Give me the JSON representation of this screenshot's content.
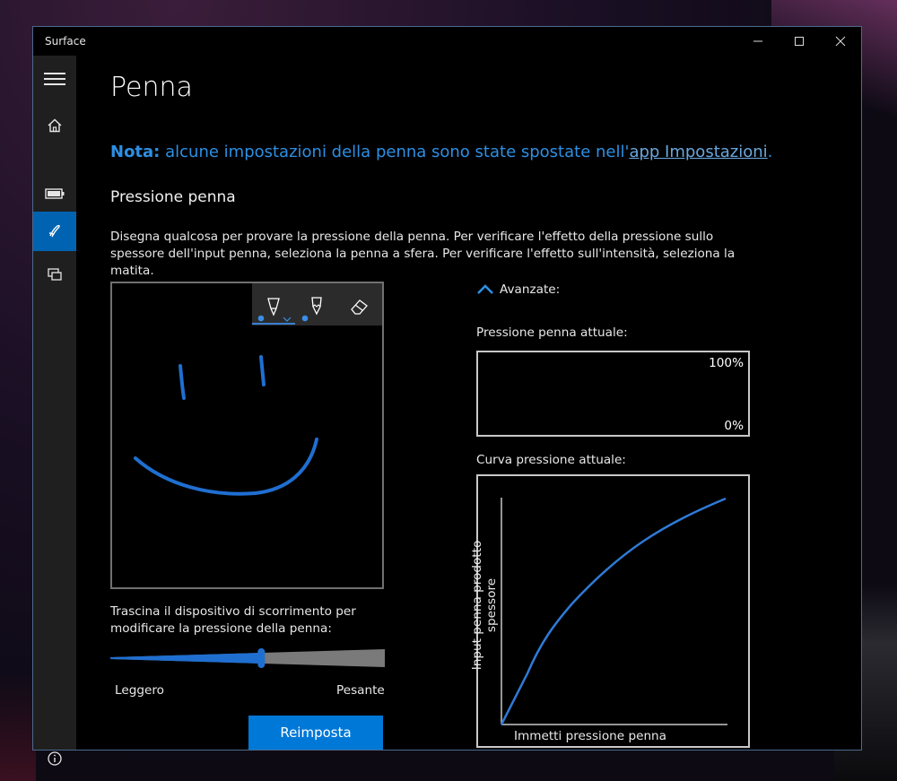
{
  "window": {
    "title": "Surface"
  },
  "page": {
    "title": "Penna",
    "note_bold": "Nota:",
    "note_text": " alcune impostazioni della penna sono state spostate nell'",
    "note_link": "app Impostazioni",
    "note_end": ".",
    "section_title": "Pressione penna",
    "description": "Disegna qualcosa per provare la pressione della penna. Per verificare l'effetto della pressione sullo spessore dell'input penna, seleziona la penna a sfera. Per verificare l'effetto sull'intensità, seleziona la matita."
  },
  "nav": {
    "items": [
      {
        "icon": "hamburger-icon"
      },
      {
        "icon": "home-icon"
      },
      {
        "icon": "battery-icon"
      },
      {
        "icon": "pen-icon",
        "active": true
      },
      {
        "icon": "devices-icon"
      },
      {
        "icon": "info-icon"
      }
    ]
  },
  "toolbar": {
    "tools": [
      "ballpoint-pen-icon",
      "pencil-icon",
      "eraser-icon"
    ],
    "selected": "ballpoint-pen-icon"
  },
  "slider": {
    "hint": "Trascina il dispositivo di scorrimento per modificare la pressione della penna:",
    "left_label": "Leggero",
    "right_label": "Pesante",
    "value": 0.55
  },
  "reset_label": "Reimposta",
  "advanced": {
    "label": "Avanzate:",
    "current_pressure_label": "Pressione penna attuale:",
    "max_label": "100%",
    "min_label": "0%",
    "curve_label": "Curva pressione attuale:",
    "curve_ylabel": "Input penna prodotto spessore",
    "curve_xlabel": "Immetti pressione penna"
  },
  "colors": {
    "accent": "#0078d7",
    "ink": "#1f6fd1",
    "sidebar": "#1f1f1f"
  }
}
